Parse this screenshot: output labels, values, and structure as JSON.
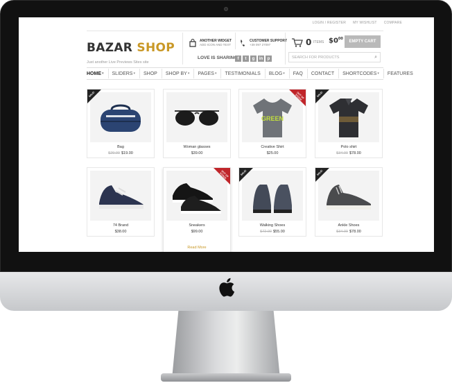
{
  "site": {
    "logo_main": "BAZAR",
    "logo_accent": "SHOP",
    "tagline": "Just another Live Previews Sites site",
    "toplinks": [
      "LOGIN / REGISTER",
      "MY WISHLIST",
      "COMPARE"
    ],
    "widget1": {
      "line1": "ANOTHER WIDGET",
      "line2": "ADD ICON AND TEXT"
    },
    "widget2": {
      "line1": "CUSTOMER SUPPORT",
      "line2": "+39 097 27097"
    },
    "cart": {
      "count": "0",
      "items_label": "ITEMS",
      "price": "$0",
      "price_cents": "00",
      "button": "EMPTY CART"
    },
    "sharing_label": "LOVE IS SHARING",
    "social": [
      "f",
      "t",
      "g",
      "in",
      "p"
    ],
    "search_placeholder": "SEARCH FOR PRODUCTS",
    "nav": [
      {
        "label": "HOME",
        "dropdown": true,
        "active": true
      },
      {
        "label": "SLIDERS",
        "dropdown": true
      },
      {
        "label": "SHOP",
        "dropdown": false
      },
      {
        "label": "SHOP BY",
        "dropdown": true
      },
      {
        "label": "PAGES",
        "dropdown": true
      },
      {
        "label": "TESTIMONIALS",
        "dropdown": false
      },
      {
        "label": "BLOG",
        "dropdown": true
      },
      {
        "label": "FAQ",
        "dropdown": false
      },
      {
        "label": "CONTACT",
        "dropdown": false
      },
      {
        "label": "SHORTCODES",
        "dropdown": true
      },
      {
        "label": "FEATURES",
        "dropdown": false
      }
    ],
    "products": [
      {
        "name": "Bag",
        "old_price": "$29.00",
        "price": "$19.00",
        "badge": "SALE!",
        "image": "duffel-bag"
      },
      {
        "name": "Woman glasses",
        "old_price": "",
        "price": "$39.00",
        "badge": "",
        "image": "sunglasses"
      },
      {
        "name": "Creative Shirt",
        "old_price": "",
        "price": "$25.00",
        "badge": "OUT OF STOCK",
        "image": "grey-tshirt"
      },
      {
        "name": "Polo shirt",
        "old_price": "$34.00",
        "price": "$78.00",
        "badge": "SALE!",
        "image": "polo-shirt"
      },
      {
        "name": "74 Brand",
        "old_price": "",
        "price": "$38.00",
        "badge": "",
        "image": "navy-sneaker"
      },
      {
        "name": "Sneakers",
        "old_price": "",
        "price": "$99.00",
        "badge": "OUT OF STOCK",
        "image": "black-sneakers",
        "readmore": "Read More"
      },
      {
        "name": "Walking Shoes",
        "old_price": "$72.00",
        "price": "$55.00",
        "badge": "SALE!",
        "image": "walking-shoes"
      },
      {
        "name": "Ankle Shoes",
        "old_price": "$34.00",
        "price": "$78.00",
        "badge": "SALE!",
        "image": "ankle-shoes"
      }
    ],
    "badge_texts": {
      "sale": "SALE!",
      "out": "OUT OF STOCK"
    }
  },
  "colors": {
    "accent": "#c99826",
    "bezel": "#111111",
    "out_ribbon": "#c0252a",
    "sale_ribbon": "#222222"
  }
}
